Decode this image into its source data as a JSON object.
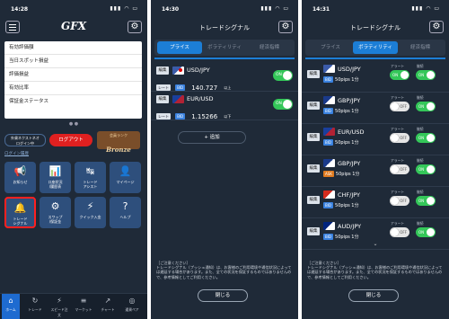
{
  "screen1": {
    "time": "14:28",
    "logo": "GFX",
    "info_rows": [
      "有効評価額",
      "当日スポット損益",
      "評価損益",
      "有効比率",
      "保証金ステータス"
    ],
    "dots": "● ●",
    "login_button": "外貨ネクストネオ\nログイン中",
    "logout_button": "ログアウト",
    "rank_label": "会員ランク",
    "rank_name": "Bronze",
    "login_history": "ログイン履歴",
    "tiles": [
      {
        "icon": "📢",
        "label": "お知らせ"
      },
      {
        "icon": "📊",
        "label": "口座状況\n/履歴表"
      },
      {
        "icon": "↹",
        "label": "トレード\nアシスト"
      },
      {
        "icon": "👤",
        "label": "マイページ"
      },
      {
        "icon": "🔔",
        "label": "トレード\nシグナル"
      },
      {
        "icon": "⚙",
        "label": "スワップ\n/保証金"
      },
      {
        "icon": "⚡",
        "label": "クイック入金"
      },
      {
        "icon": "?",
        "label": "ヘルプ"
      }
    ],
    "tabs": [
      {
        "icon": "⌂",
        "label": "ホーム"
      },
      {
        "icon": "↻",
        "label": "トレード"
      },
      {
        "icon": "⚡",
        "label": "スピード注文"
      },
      {
        "icon": "≡",
        "label": "マーケット"
      },
      {
        "icon": "↗",
        "label": "チャート"
      },
      {
        "icon": "◎",
        "label": "通貨ペア"
      }
    ]
  },
  "screen2": {
    "time": "14:30",
    "title": "トレードシグナル",
    "tabs": [
      "プライス",
      "ボラティリティ",
      "経済指標"
    ],
    "rows": [
      {
        "edit": "編集",
        "pair": "USD/JPY",
        "tag1": "レート",
        "tag2": "BID",
        "value": "140.727",
        "suffix": "以上",
        "toggle": "ON"
      },
      {
        "edit": "編集",
        "pair": "EUR/USD",
        "tag1": "レート",
        "tag2": "BID",
        "value": "1.15266",
        "suffix": "以下",
        "toggle": "ON"
      }
    ],
    "add_button": "+ 追加",
    "notice_head": "［ご注意ください］",
    "notice_body": "トレードシグナル（プッシュ通知）は、お客様のご利用環境や通信状況によっては遅延する場合があります。また、全ての状況を保証するものではありませんので、参考情報としてご利用ください。",
    "close_button": "閉じる"
  },
  "screen3": {
    "time": "14:31",
    "title": "トレードシグナル",
    "tabs": [
      "プライス",
      "ボラティリティ",
      "経済指標"
    ],
    "alert_label": "アラート",
    "repeat_label": "継続",
    "rows": [
      {
        "edit": "編集",
        "pair": "USD/JPY",
        "tag": "BID",
        "text": "50pips 1分",
        "alert": "ON",
        "repeat": "ON"
      },
      {
        "edit": "編集",
        "pair": "GBP/JPY",
        "tag": "BID",
        "text": "50pips 1分",
        "alert": "OFF",
        "repeat": "ON"
      },
      {
        "edit": "編集",
        "pair": "EUR/USD",
        "tag": "BID",
        "text": "50pips 1分",
        "alert": "OFF",
        "repeat": "ON"
      },
      {
        "edit": "編集",
        "pair": "GBP/JPY",
        "tag": "ASK",
        "text": "50pips 1分",
        "alert": "OFF",
        "repeat": "ON"
      },
      {
        "edit": "編集",
        "pair": "CHF/JPY",
        "tag": "BID",
        "text": "50pips 1分",
        "alert": "OFF",
        "repeat": "ON"
      },
      {
        "edit": "編集",
        "pair": "AUD/JPY",
        "tag": "BID",
        "text": "50pips 1分",
        "alert": "OFF",
        "repeat": "ON"
      }
    ],
    "notice_head": "［ご注意ください］",
    "notice_body": "トレードシグナル（プッシュ通知）は、お客様のご利用環境や通信状況によっては遅延する場合があります。また、全ての状況を保証するものではありませんので、参考情報としてご利用ください。",
    "close_button": "閉じる"
  },
  "colors": {
    "background": "#1f2a38",
    "accent": "#1c7ed6",
    "toggle_on": "#34c759",
    "logout": "#e02020",
    "tile": "#2e4f7c"
  }
}
